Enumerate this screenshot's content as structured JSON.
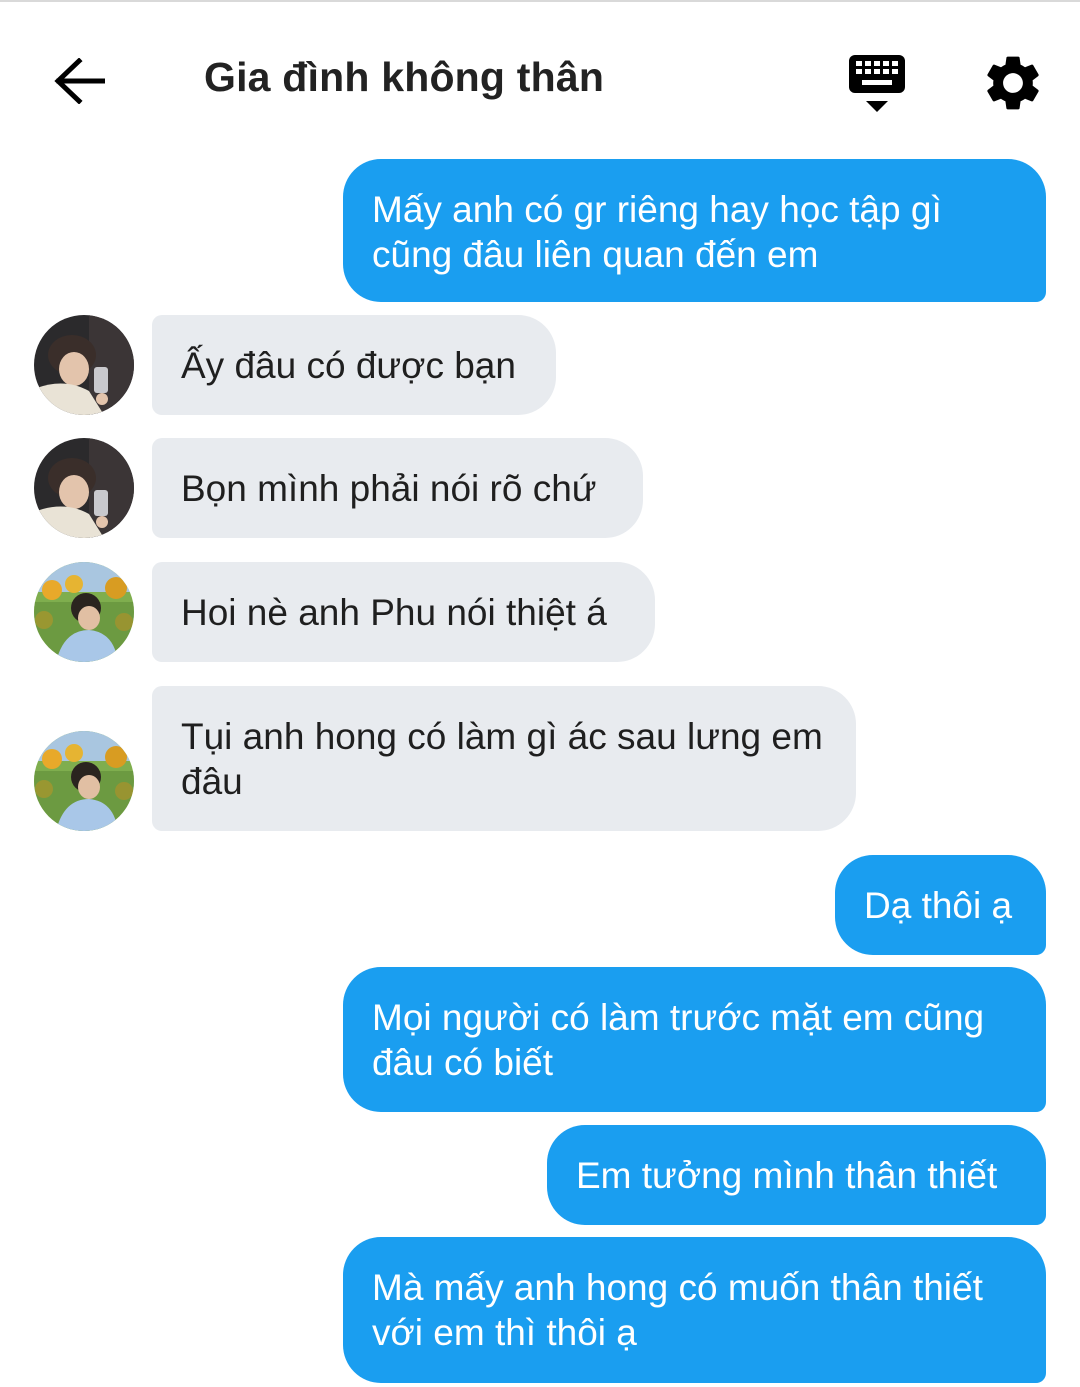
{
  "header": {
    "title": "Gia đình không thân",
    "back_icon": "arrow-left-icon",
    "keyboard_icon": "keyboard-icon",
    "settings_icon": "gear-icon"
  },
  "colors": {
    "outgoing_bubble": "#1a9ef0",
    "incoming_bubble": "#e8ebef",
    "header_icons": "#000000"
  },
  "messages": [
    {
      "direction": "outgoing",
      "text": "Mấy anh có gr riêng hay học tập gì cũng đâu liên quan đến em"
    },
    {
      "direction": "incoming",
      "sender_avatar": "avatar-1",
      "text": "Ấy đâu có được bạn"
    },
    {
      "direction": "incoming",
      "sender_avatar": "avatar-1",
      "text": "Bọn mình phải nói rõ chứ"
    },
    {
      "direction": "incoming",
      "sender_avatar": "avatar-2",
      "text": "Hoi nè anh Phu nói thiệt á"
    },
    {
      "direction": "incoming",
      "sender_avatar": "avatar-2",
      "text": "Tụi anh hong có làm gì ác sau lưng em đâu"
    },
    {
      "direction": "outgoing",
      "text": "Dạ thôi ạ"
    },
    {
      "direction": "outgoing",
      "text": "Mọi người có làm trước mặt em cũng đâu có biết"
    },
    {
      "direction": "outgoing",
      "text": "Em tưởng mình thân thiết"
    },
    {
      "direction": "outgoing",
      "text": "Mà mấy anh hong có muốn thân thiết với em thì thôi ạ"
    }
  ]
}
